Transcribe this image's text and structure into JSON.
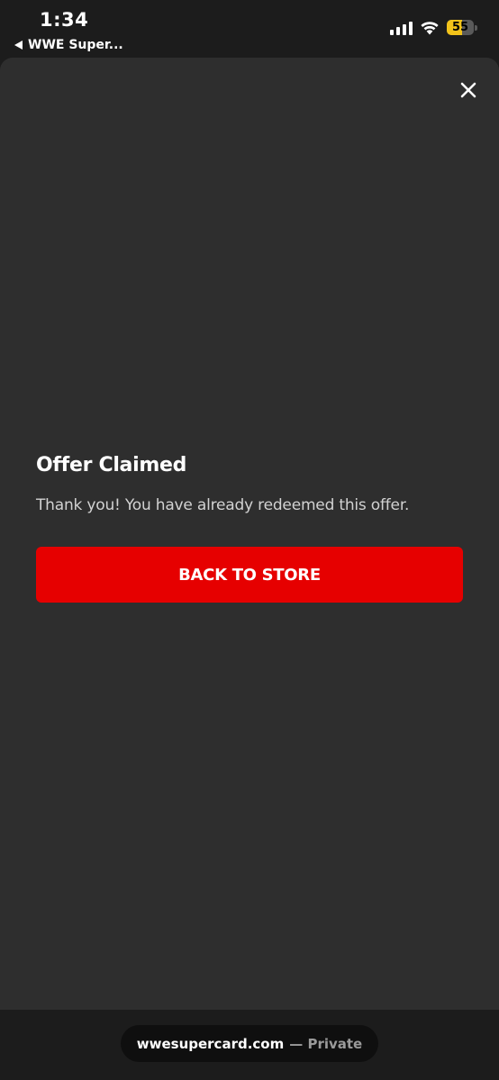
{
  "status_bar": {
    "time": "1:34",
    "back_label": "WWE Super...",
    "battery_level": "55",
    "battery_fraction": 0.55
  },
  "dialog": {
    "title": "Offer Claimed",
    "message": "Thank you! You have already redeemed this offer.",
    "button_label": "BACK TO STORE",
    "close_icon": "close-icon"
  },
  "browser": {
    "domain": "wwesupercard.com",
    "mode": "— Private"
  },
  "colors": {
    "accent": "#e60000",
    "sheet_background": "#2e2e2e",
    "battery": "#f2c31a"
  }
}
